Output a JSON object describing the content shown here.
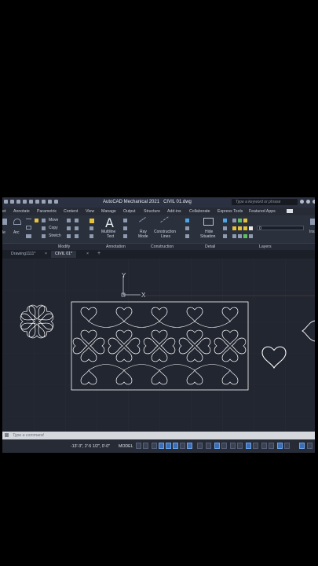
{
  "app": {
    "title": "AutoCAD Mechanical 2021",
    "file": "CIVIL 01.dwg",
    "search_placeholder": "Type a keyword or phrase"
  },
  "ribbon_tabs": [
    "et",
    "Annotate",
    "Parametric",
    "Content",
    "View",
    "Manage",
    "Output",
    "Structure",
    "Add-ins",
    "Collaborate",
    "Express Tools",
    "Featured Apps"
  ],
  "ribbon": {
    "draw_partial": "le",
    "arc": "Arc",
    "modify": {
      "move": "Move",
      "copy": "Copy",
      "stretch": "Stretch"
    },
    "multiline_text_1": "Multiline",
    "multiline_text_2": "Text",
    "ray_1": "Ray",
    "ray_2": "Mode",
    "construction_1": "Construction",
    "construction_2": "Lines",
    "hide_1": "Hide",
    "hide_2": "Situation",
    "layer_value": "0",
    "insert_partial": "Ins"
  },
  "panels": {
    "modify": "Modify",
    "annotation": "Annotation",
    "construction": "Construction",
    "detail": "Detail",
    "layers": "Layers"
  },
  "file_tabs": [
    {
      "label": "Drawing1111*",
      "active": false
    },
    {
      "label": "CIVIL 01*",
      "active": true
    }
  ],
  "ucs": {
    "x_label": "X",
    "y_label": "Y"
  },
  "command_placeholder": "Type a command",
  "status": {
    "coords": "-13'-3\", 2'-5 1/2\", 0'-0\"",
    "model": "MODEL"
  },
  "colors": {
    "canvas_bg": "#222630",
    "linework": "#ffffff",
    "ucs": "#cfd4dc",
    "ribbon_bg": "#2a303c"
  }
}
